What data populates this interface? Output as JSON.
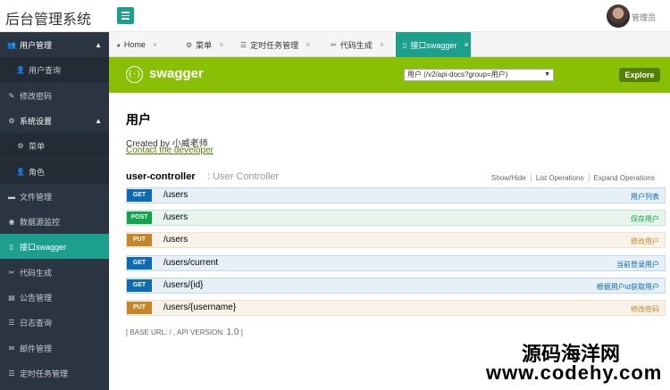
{
  "app": {
    "title": "后台管理系统",
    "user": "管理员"
  },
  "sidebar": {
    "items": [
      {
        "label": "用户管理",
        "icon": "users-icon",
        "glyph": "👥",
        "kind": "group",
        "caret": "▲"
      },
      {
        "label": "用户查询",
        "icon": "user-icon",
        "glyph": "👤",
        "kind": "sub"
      },
      {
        "label": "修改密码",
        "icon": "edit-icon",
        "glyph": "✎",
        "kind": "item"
      },
      {
        "label": "系统设置",
        "icon": "cogs-icon",
        "glyph": "⚙",
        "kind": "group",
        "caret": "▲"
      },
      {
        "label": "菜单",
        "icon": "gear-icon",
        "glyph": "⚙",
        "kind": "sub"
      },
      {
        "label": "角色",
        "icon": "user-icon",
        "glyph": "👤",
        "kind": "sub"
      },
      {
        "label": "文件管理",
        "icon": "folder-icon",
        "glyph": "▬",
        "kind": "item"
      },
      {
        "label": "数据源监控",
        "icon": "eye-icon",
        "glyph": "◉",
        "kind": "item"
      },
      {
        "label": "接口swagger",
        "icon": "file-icon",
        "glyph": "▯",
        "kind": "active"
      },
      {
        "label": "代码生成",
        "icon": "wrench-icon",
        "glyph": "✂",
        "kind": "item"
      },
      {
        "label": "公告管理",
        "icon": "book-icon",
        "glyph": "▤",
        "kind": "item"
      },
      {
        "label": "日志查询",
        "icon": "list-icon",
        "glyph": "☰",
        "kind": "item"
      },
      {
        "label": "邮件管理",
        "icon": "envelope-icon",
        "glyph": "✉",
        "kind": "item"
      },
      {
        "label": "定时任务管理",
        "icon": "tasks-icon",
        "glyph": "☰",
        "kind": "item"
      }
    ]
  },
  "tabs": [
    {
      "label": "Home",
      "icon": "dashboard-icon",
      "glyph": "◕"
    },
    {
      "label": "菜单",
      "icon": "gear-icon",
      "glyph": "⚙"
    },
    {
      "label": "定时任务管理",
      "icon": "tasks-icon",
      "glyph": "☰"
    },
    {
      "label": "代码生成",
      "icon": "wrench-icon",
      "glyph": "✂"
    },
    {
      "label": "接口swagger",
      "icon": "file-icon",
      "glyph": "▯",
      "active": true
    }
  ],
  "swagger": {
    "logo_glyph": "{-}",
    "title": "swagger",
    "select_value": "用户 (/v2/api-docs?group=用户)",
    "explore_label": "Explore",
    "api_title": "用户",
    "created_by": "Created by 小威老师",
    "contact": "Contact the developer",
    "controller_name": "user-controller",
    "controller_desc": ": User Controller",
    "links": [
      "Show/Hide",
      "List Operations",
      "Expand Operations"
    ],
    "operations": [
      {
        "method": "GET",
        "path": "/users",
        "summary": "用户列表"
      },
      {
        "method": "POST",
        "path": "/users",
        "summary": "保存用户"
      },
      {
        "method": "PUT",
        "path": "/users",
        "summary": "修改用户"
      },
      {
        "method": "GET",
        "path": "/users/current",
        "summary": "当前登录用户"
      },
      {
        "method": "GET",
        "path": "/users/{id}",
        "summary": "根据用户id获取用户"
      },
      {
        "method": "PUT",
        "path": "/users/{username}",
        "summary": "修改密码"
      }
    ],
    "footer_prefix": "[ BASE URL: / , API VERSION: ",
    "footer_version": "1.0",
    "footer_suffix": " ]"
  },
  "watermark": {
    "line1": "源码海洋网",
    "line2": "www.codehy.com"
  },
  "colors": {
    "accent": "#1c9f8c",
    "sidebar_bg": "#2b3542",
    "swagger_green": "#89bf04",
    "get": "#0f6ab4",
    "post": "#10a54a",
    "put": "#c5862b"
  }
}
